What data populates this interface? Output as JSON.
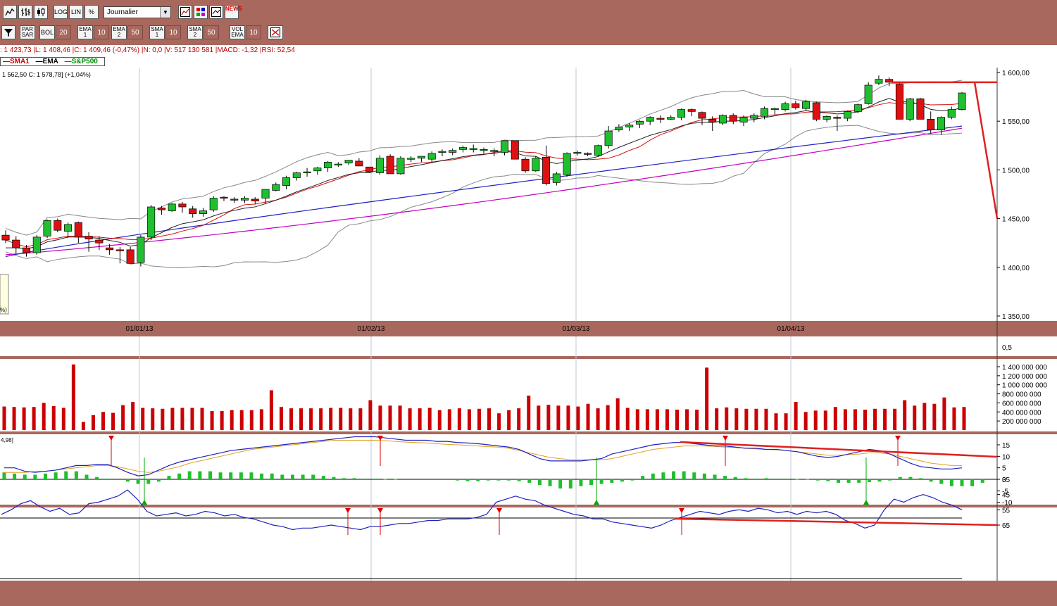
{
  "toolbar1": {
    "log_label": "LOG",
    "lin_label": "LIN",
    "pct_label": "%",
    "period_value": "Journalier",
    "news_label": "NEWS"
  },
  "toolbar2": {
    "parsar_label": "PAR SAR",
    "bol_label": "BOL",
    "bol_period": "20",
    "ema1_label": "EMA 1",
    "ema1_period": "10",
    "ema2_label": "EMA 2",
    "ema2_period": "50",
    "sma1_label": "SMA 1",
    "sma1_period": "10",
    "sma2_label": "SMA 2",
    "sma2_period": "50",
    "volema_label": "VOL EMA",
    "volema_period": "10"
  },
  "info_line": ": 1 423,73 |L: 1 408,46 |C: 1 409,46 (-0,47%) |N: 0,0 |V: 517 130 581 |MACD: -1,32 |RSI: 52,54",
  "legend": {
    "sma1": "SMA1",
    "ema": "EMA",
    "sp500": "S&P500"
  },
  "price_note": "1 562,50  C: 1 578,78] (+1,04%)",
  "tooltip_text": "%)",
  "macd_param": "4,98]",
  "colors": {
    "background": "#a8685e",
    "up_candle": "#1fbf2f",
    "down_candle": "#dd1111",
    "volume": "#cc0000",
    "ema": "#222222",
    "sma50": "#c000c0",
    "ema50": "#2020c0",
    "bollinger": "#888888",
    "trendline": "#e02020"
  },
  "chart_data": {
    "type": "candlestick",
    "price_axis": {
      "min": 1350,
      "max": 1600,
      "ticks": [
        "1 600,00",
        "1 550,00",
        "1 500,00",
        "1 450,00",
        "1 400,00",
        "1 350,00"
      ]
    },
    "date_labels": [
      "01/01/13",
      "01/02/13",
      "01/03/13",
      "01/04/13"
    ],
    "candles": [
      [
        1433,
        1438,
        1425,
        1428
      ],
      [
        1428,
        1432,
        1414,
        1420
      ],
      [
        1420,
        1423,
        1411,
        1415
      ],
      [
        1415,
        1433,
        1413,
        1431
      ],
      [
        1432,
        1449,
        1430,
        1448
      ],
      [
        1448,
        1450,
        1436,
        1438
      ],
      [
        1437,
        1446,
        1430,
        1444
      ],
      [
        1446,
        1447,
        1425,
        1431
      ],
      [
        1432,
        1436,
        1416,
        1429
      ],
      [
        1428,
        1432,
        1418,
        1425
      ],
      [
        1420,
        1424,
        1413,
        1418
      ],
      [
        1418,
        1421,
        1404,
        1417
      ],
      [
        1418,
        1421,
        1404,
        1404
      ],
      [
        1405,
        1433,
        1401,
        1431
      ],
      [
        1431,
        1464,
        1428,
        1462
      ],
      [
        1461,
        1463,
        1454,
        1459
      ],
      [
        1458,
        1466,
        1457,
        1465
      ],
      [
        1465,
        1467,
        1456,
        1462
      ],
      [
        1460,
        1463,
        1451,
        1455
      ],
      [
        1455,
        1461,
        1452,
        1458
      ],
      [
        1459,
        1473,
        1457,
        1471
      ],
      [
        1472,
        1473,
        1468,
        1471
      ],
      [
        1470,
        1472,
        1466,
        1469
      ],
      [
        1469,
        1473,
        1466,
        1471
      ],
      [
        1470,
        1472,
        1465,
        1468
      ],
      [
        1471,
        1480,
        1465,
        1480
      ],
      [
        1479,
        1487,
        1478,
        1485
      ],
      [
        1484,
        1494,
        1480,
        1492
      ],
      [
        1492,
        1498,
        1489,
        1497
      ],
      [
        1497,
        1502,
        1493,
        1498
      ],
      [
        1499,
        1503,
        1495,
        1502
      ],
      [
        1502,
        1509,
        1498,
        1508
      ],
      [
        1506,
        1508,
        1503,
        1506
      ],
      [
        1507,
        1510,
        1505,
        1510
      ],
      [
        1509,
        1512,
        1504,
        1504
      ],
      [
        1503,
        1503,
        1497,
        1498
      ],
      [
        1497,
        1515,
        1495,
        1512
      ],
      [
        1514,
        1516,
        1496,
        1496
      ],
      [
        1496,
        1514,
        1495,
        1512
      ],
      [
        1512,
        1514,
        1508,
        1512
      ],
      [
        1512,
        1514,
        1508,
        1514
      ],
      [
        1511,
        1519,
        1508,
        1517
      ],
      [
        1518,
        1521,
        1514,
        1519
      ],
      [
        1518,
        1522,
        1515,
        1520
      ],
      [
        1521,
        1525,
        1518,
        1523
      ],
      [
        1522,
        1526,
        1518,
        1522
      ],
      [
        1521,
        1523,
        1517,
        1521
      ],
      [
        1520,
        1522,
        1514,
        1520
      ],
      [
        1518,
        1530,
        1515,
        1530
      ],
      [
        1530,
        1530,
        1511,
        1511
      ],
      [
        1511,
        1513,
        1497,
        1499
      ],
      [
        1499,
        1514,
        1498,
        1512
      ],
      [
        1513,
        1525,
        1484,
        1486
      ],
      [
        1487,
        1498,
        1484,
        1496
      ],
      [
        1495,
        1518,
        1493,
        1517
      ],
      [
        1517,
        1520,
        1515,
        1518
      ],
      [
        1517,
        1518,
        1514,
        1516
      ],
      [
        1515,
        1526,
        1514,
        1525
      ],
      [
        1525,
        1545,
        1522,
        1540
      ],
      [
        1541,
        1547,
        1539,
        1544
      ],
      [
        1544,
        1548,
        1540,
        1546
      ],
      [
        1547,
        1551,
        1543,
        1550
      ],
      [
        1550,
        1555,
        1546,
        1554
      ],
      [
        1553,
        1556,
        1548,
        1552
      ],
      [
        1552,
        1556,
        1551,
        1554
      ],
      [
        1554,
        1563,
        1551,
        1562
      ],
      [
        1562,
        1563,
        1555,
        1560
      ],
      [
        1559,
        1560,
        1546,
        1553
      ],
      [
        1552,
        1555,
        1540,
        1549
      ],
      [
        1548,
        1557,
        1546,
        1556
      ],
      [
        1556,
        1558,
        1547,
        1550
      ],
      [
        1549,
        1556,
        1545,
        1554
      ],
      [
        1553,
        1558,
        1549,
        1556
      ],
      [
        1555,
        1565,
        1552,
        1563
      ],
      [
        1563,
        1564,
        1557,
        1563
      ],
      [
        1562,
        1570,
        1560,
        1568
      ],
      [
        1568,
        1571,
        1562,
        1564
      ],
      [
        1563,
        1572,
        1561,
        1570
      ],
      [
        1569,
        1570,
        1550,
        1552
      ],
      [
        1552,
        1556,
        1549,
        1555
      ],
      [
        1554,
        1556,
        1540,
        1553
      ],
      [
        1553,
        1561,
        1550,
        1560
      ],
      [
        1560,
        1568,
        1558,
        1567
      ],
      [
        1568,
        1590,
        1567,
        1587
      ],
      [
        1589,
        1597,
        1587,
        1593
      ],
      [
        1593,
        1595,
        1586,
        1590
      ],
      [
        1588,
        1589,
        1552,
        1552
      ],
      [
        1552,
        1574,
        1550,
        1573
      ],
      [
        1573,
        1574,
        1552,
        1552
      ],
      [
        1552,
        1560,
        1537,
        1541
      ],
      [
        1541,
        1555,
        1536,
        1554
      ],
      [
        1554,
        1565,
        1552,
        1562
      ],
      [
        1562,
        1580,
        1561,
        1579
      ]
    ],
    "volume_axis": [
      "1 400 000 000",
      "1 200 000 000",
      "1 000 000 000",
      "800 000 000",
      "600 000 000",
      "400 000 000",
      "200 000 000"
    ],
    "volumes": [
      520,
      510,
      500,
      510,
      600,
      530,
      490,
      1450,
      180,
      330,
      400,
      380,
      550,
      620,
      490,
      480,
      470,
      490,
      490,
      490,
      490,
      420,
      420,
      440,
      440,
      440,
      460,
      880,
      510,
      480,
      480,
      480,
      480,
      490,
      490,
      480,
      480,
      660,
      540,
      540,
      540,
      480,
      480,
      490,
      440,
      460,
      480,
      460,
      470,
      480,
      370,
      440,
      480,
      760,
      540,
      560,
      540,
      540,
      520,
      580,
      480,
      550,
      700,
      490,
      460,
      460,
      460,
      460,
      450,
      460,
      450,
      1380,
      480,
      500,
      480,
      470,
      470,
      470,
      370,
      370,
      620,
      400,
      430,
      430,
      510,
      460,
      460,
      450,
      470,
      470,
      470,
      660,
      540,
      600,
      580,
      720,
      500,
      510
    ],
    "macd_axis": [
      "15",
      "10",
      "5",
      "0",
      "-5",
      "-10"
    ],
    "macd_line": [
      5,
      5,
      3.5,
      3,
      3.5,
      4,
      5,
      6,
      6,
      6.5,
      6.5,
      5,
      3,
      1.5,
      2,
      4,
      6,
      7.5,
      8.5,
      9.5,
      10.5,
      11.5,
      12.5,
      13,
      13.5,
      14,
      14.5,
      15,
      15.5,
      16,
      16.5,
      17,
      17.5,
      18,
      18.5,
      18.5,
      18.5,
      18,
      17.5,
      17,
      17,
      17,
      16.5,
      16.5,
      16,
      15.8,
      15.5,
      15,
      14.5,
      14,
      13,
      11,
      9,
      8,
      8,
      8,
      8,
      8.5,
      9,
      11,
      12,
      13,
      14,
      15,
      15.5,
      16,
      16,
      15.5,
      15,
      14.5,
      14.5,
      14,
      13.5,
      13.5,
      13,
      13,
      12.5,
      12,
      11,
      10,
      9.5,
      10,
      11,
      12,
      13,
      12.5,
      11,
      9,
      7,
      5.5,
      5,
      4.5,
      4.5,
      5
    ],
    "macd_signal": [
      3,
      3,
      3,
      3.5,
      3.5,
      4,
      4.5,
      5,
      5.5,
      6,
      6,
      5.5,
      4.5,
      3.5,
      3,
      3.5,
      4.5,
      5.5,
      7,
      8,
      9,
      10,
      11,
      12,
      13,
      13.5,
      14,
      14.5,
      15,
      15.5,
      16,
      16.5,
      17,
      17,
      17,
      17,
      17,
      16.8,
      16.5,
      16.2,
      16,
      15.8,
      15.5,
      15.2,
      15,
      14.8,
      14.5,
      14.2,
      14,
      13.5,
      12.5,
      11.5,
      10.5,
      9.5,
      9,
      8.5,
      8.5,
      8.5,
      8.5,
      9,
      10,
      11,
      12,
      13,
      13.5,
      14,
      14.5,
      14.5,
      14.5,
      14.3,
      14,
      13.8,
      13.5,
      13.2,
      13,
      12.8,
      12.5,
      12,
      11.5,
      11,
      10.5,
      10.5,
      10.8,
      11,
      11.5,
      11.5,
      11,
      10,
      9,
      8,
      7,
      6.5,
      6,
      6
    ],
    "macd_hist": [
      3,
      2.5,
      2,
      2,
      2.5,
      3,
      3.5,
      3.5,
      2,
      1,
      0.3,
      0,
      -1,
      -2,
      -2,
      -1,
      1.5,
      2.5,
      3.5,
      3.5,
      3.5,
      3,
      3,
      3,
      3,
      2.5,
      2.5,
      2,
      2,
      2,
      2,
      1.5,
      1,
      0.5,
      0.5,
      0.3,
      0.3,
      0.2,
      0.2,
      0,
      0,
      0,
      -0.2,
      -0.3,
      -0.5,
      -0.8,
      -0.8,
      -0.5,
      -0.5,
      -0.5,
      -0.8,
      -1.5,
      -2.5,
      -3,
      -4,
      -4,
      -3,
      -2.5,
      -2,
      -1.5,
      -1,
      -0.5,
      1.5,
      2.5,
      3,
      3.5,
      3.5,
      3,
      2.5,
      2,
      1.5,
      1,
      0.5,
      0.3,
      0.5,
      0.3,
      0.3,
      0.2,
      0.1,
      -0.5,
      -0.8,
      -1.5,
      -1.5,
      -1.5,
      -1.2,
      -1,
      -0.5,
      1,
      1,
      0.5,
      -1,
      -2,
      -3,
      -3,
      -3,
      -1.5
    ],
    "rsi_axis": [
      "65",
      "55",
      "45",
      "35"
    ],
    "rsi": [
      58,
      55,
      51,
      49,
      53,
      56,
      54,
      58,
      57,
      51,
      50,
      48,
      46,
      42,
      48,
      56,
      59,
      58,
      57,
      59,
      58,
      56,
      57,
      59,
      58,
      60,
      61,
      63,
      65,
      66,
      68,
      67,
      67,
      66,
      65,
      66,
      67,
      68,
      66,
      66,
      65,
      64,
      64,
      63,
      62,
      62,
      61,
      61,
      61,
      60,
      58,
      50,
      48,
      46,
      48,
      49,
      52,
      54,
      56,
      58,
      59,
      61,
      61,
      63,
      64,
      65,
      66,
      67,
      65,
      62,
      60,
      58,
      56,
      57,
      58,
      56,
      55,
      56,
      54,
      55,
      57,
      56,
      58,
      56,
      57,
      56,
      58,
      62,
      64,
      67,
      65,
      55,
      48,
      50,
      47,
      45,
      47,
      50,
      52,
      55
    ],
    "trendlines": "red annotation lines drawn by user on price, MACD and RSI panes"
  }
}
